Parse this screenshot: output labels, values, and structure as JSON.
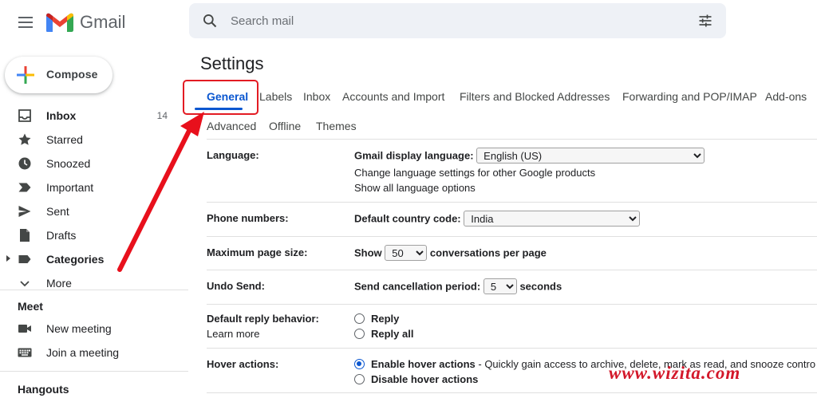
{
  "app": {
    "brand": "Gmail",
    "brand_colors": {
      "red": "#EA4335",
      "blue": "#4285F4",
      "green": "#34A853",
      "yellow": "#FBBC04"
    }
  },
  "search": {
    "placeholder": "Search mail"
  },
  "compose": {
    "label": "Compose"
  },
  "sidebar": {
    "items": [
      {
        "label": "Inbox",
        "count": "14",
        "icon": "inbox-icon",
        "bold": true
      },
      {
        "label": "Starred",
        "icon": "star-icon"
      },
      {
        "label": "Snoozed",
        "icon": "clock-icon"
      },
      {
        "label": "Important",
        "icon": "important-icon"
      },
      {
        "label": "Sent",
        "icon": "send-icon"
      },
      {
        "label": "Drafts",
        "icon": "draft-icon"
      },
      {
        "label": "Categories",
        "icon": "label-icon",
        "bold": true
      },
      {
        "label": "More",
        "icon": "chevron-down-icon"
      }
    ],
    "meet": {
      "title": "Meet",
      "items": [
        {
          "label": "New meeting",
          "icon": "video-icon"
        },
        {
          "label": "Join a meeting",
          "icon": "keyboard-icon"
        }
      ]
    },
    "hangouts": {
      "title": "Hangouts"
    }
  },
  "settings": {
    "title": "Settings",
    "tabs": [
      "General",
      "Labels",
      "Inbox",
      "Accounts and Import",
      "Filters and Blocked Addresses",
      "Forwarding and POP/IMAP",
      "Add-ons",
      "Advanced",
      "Offline",
      "Themes"
    ],
    "active_tab": "General",
    "rows": {
      "language": {
        "label": "Language:",
        "display_label": "Gmail display language:",
        "display_value": "English (US)",
        "link1": "Change language settings for other Google products",
        "link2": "Show all language options"
      },
      "phone": {
        "label": "Phone numbers:",
        "field_label": "Default country code:",
        "value": "India"
      },
      "page_size": {
        "label": "Maximum page size:",
        "prefix": "Show",
        "value": "50",
        "suffix": "conversations per page"
      },
      "undo": {
        "label": "Undo Send:",
        "field_label": "Send cancellation period:",
        "value": "5",
        "suffix": "seconds"
      },
      "reply": {
        "label": "Default reply behavior:",
        "learn_more": "Learn more",
        "opt1": "Reply",
        "opt2": "Reply all"
      },
      "hover": {
        "label": "Hover actions:",
        "opt1_bold": "Enable hover actions",
        "opt1_rest": " - Quickly gain access to archive, delete, mark as read, and snooze contro",
        "opt2": "Disable hover actions"
      }
    }
  },
  "watermark": "www.wizita.com"
}
